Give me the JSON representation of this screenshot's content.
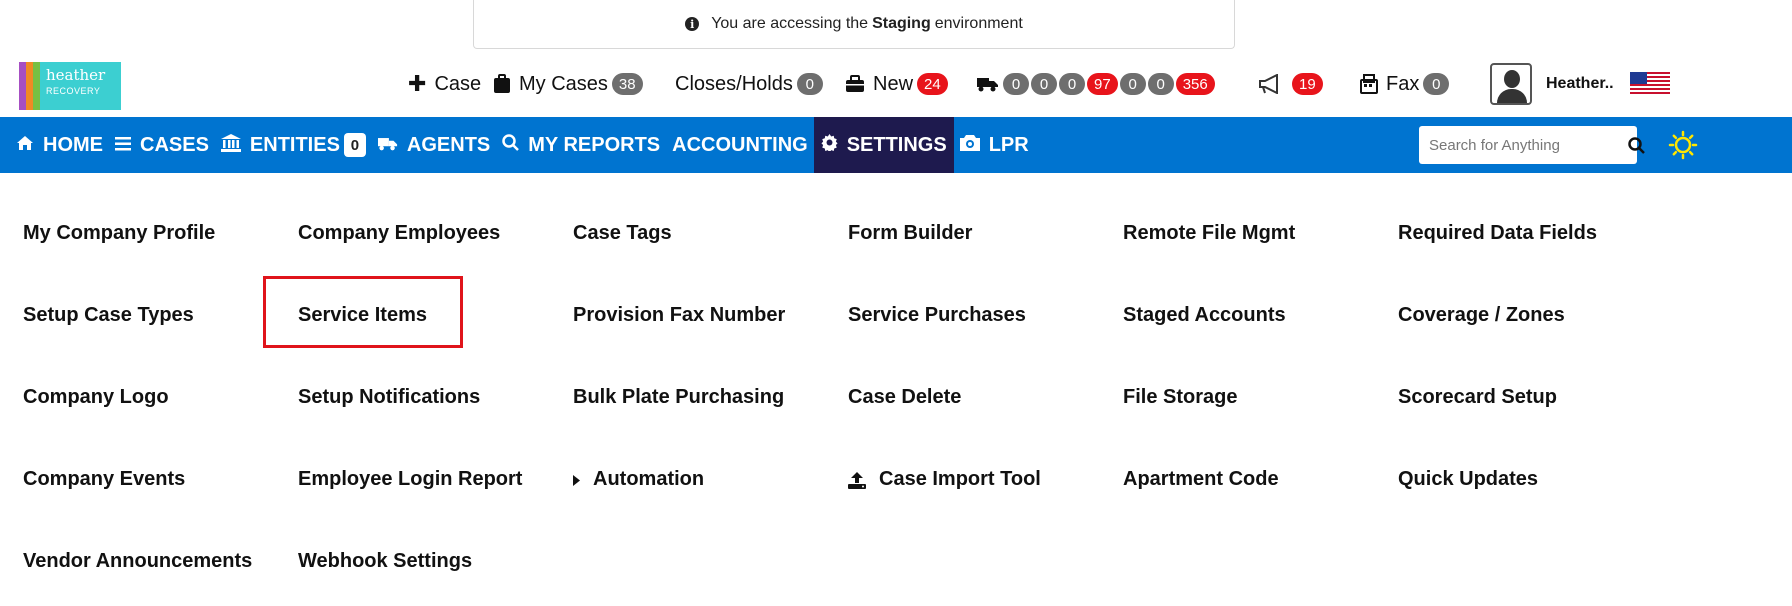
{
  "banner": {
    "prefix": "You are accessing the",
    "env": "Staging",
    "suffix": "environment",
    "icon": "info-circle-icon"
  },
  "logo": {
    "line1": "heather",
    "line2": "RECOVERY",
    "stripe_colors": [
      "#a64fc3",
      "#f08a24",
      "#77c043"
    ],
    "box_color": "#3ccfd1"
  },
  "topbar": {
    "new_case_label": "Case",
    "my_cases_label": "My Cases",
    "my_cases_count": "38",
    "closes_holds_label": "Closes/Holds",
    "closes_holds_count": "0",
    "new_label": "New",
    "new_count": "24",
    "truck_counts": [
      "0",
      "0",
      "0",
      "97",
      "0",
      "0",
      "356"
    ],
    "truck_count_colors": [
      "gray",
      "gray",
      "gray",
      "red",
      "gray",
      "gray",
      "red"
    ],
    "announcements_count": "19",
    "fax_label": "Fax",
    "fax_count": "0",
    "user_name": "Heather.."
  },
  "nav": {
    "home": "HOME",
    "cases": "CASES",
    "entities": "ENTITIES",
    "entities_count": "0",
    "agents": "AGENTS",
    "my_reports": "MY REPORTS",
    "accounting": "ACCOUNTING",
    "settings": "SETTINGS",
    "lpr": "LPR",
    "search_placeholder": "Search for Anything",
    "active_color": "#1e1a4e",
    "bar_color": "#0074d0"
  },
  "settings_grid": {
    "col1": [
      "My Company Profile",
      "Setup Case Types",
      "Company Logo",
      "Company Events",
      "Vendor Announcements"
    ],
    "col2": [
      "Company Employees",
      "Service Items",
      "Setup Notifications",
      "Employee Login Report",
      "Webhook Settings"
    ],
    "col3": [
      "Case Tags",
      "Provision Fax Number",
      "Bulk Plate Purchasing",
      "Automation"
    ],
    "col4": [
      "Form Builder",
      "Service Purchases",
      "Case Delete",
      "Case Import Tool"
    ],
    "col5": [
      "Remote File Mgmt",
      "Staged Accounts",
      "File Storage",
      "Apartment Code"
    ],
    "col6": [
      "Required Data Fields",
      "Coverage / Zones",
      "Scorecard Setup",
      "Quick Updates"
    ],
    "highlighted": "Service Items",
    "highlight_color": "#e0141b"
  }
}
